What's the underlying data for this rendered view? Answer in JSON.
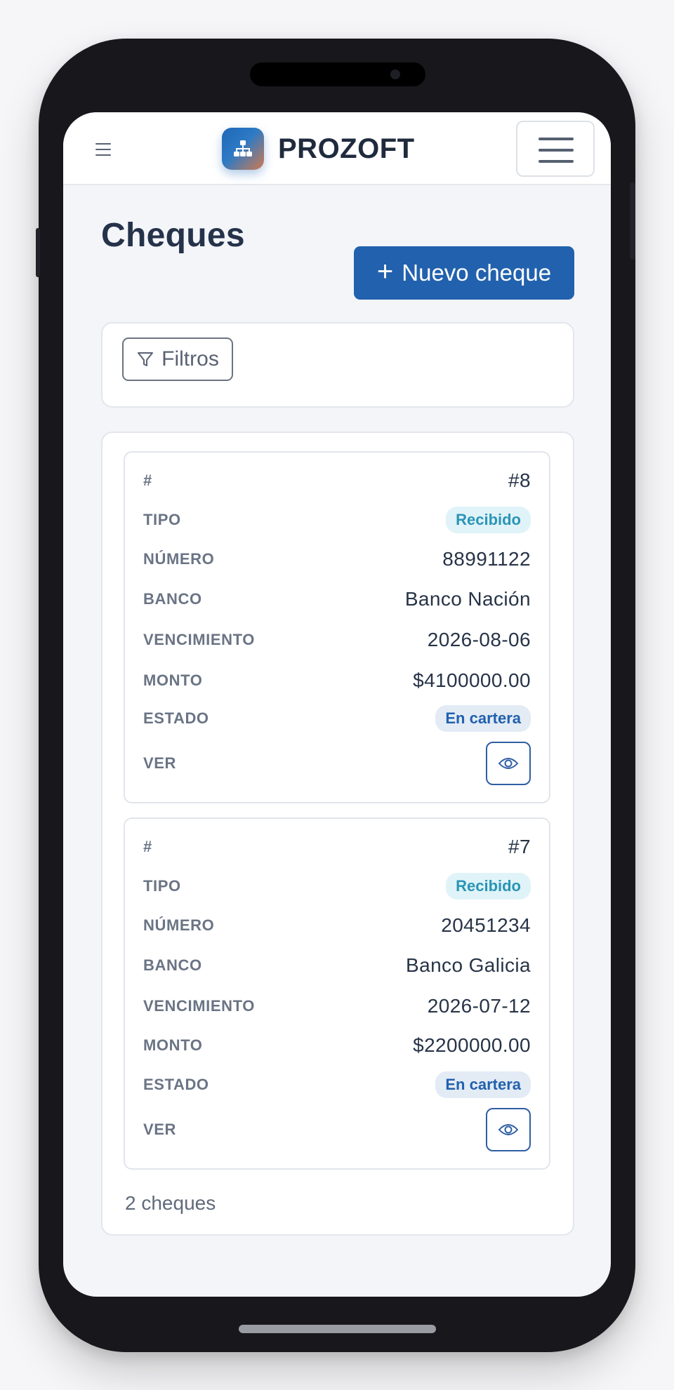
{
  "header": {
    "brand": "PROZOFT"
  },
  "page": {
    "title": "Cheques",
    "new_button_label": "Nuevo cheque",
    "filters_label": "Filtros"
  },
  "labels": {
    "id": "#",
    "tipo": "TIPO",
    "numero": "NÚMERO",
    "banco": "BANCO",
    "vencimiento": "VENCIMIENTO",
    "monto": "MONTO",
    "estado": "ESTADO",
    "ver": "VER"
  },
  "cheques": [
    {
      "id": "#8",
      "tipo": "Recibido",
      "numero": "88991122",
      "banco": "Banco Nación",
      "vencimiento": "2026-08-06",
      "monto": "$4100000.00",
      "estado": "En cartera"
    },
    {
      "id": "#7",
      "tipo": "Recibido",
      "numero": "20451234",
      "banco": "Banco Galicia",
      "vencimiento": "2026-07-12",
      "monto": "$2200000.00",
      "estado": "En cartera"
    }
  ],
  "footer": {
    "count_text": "2 cheques"
  },
  "icons": {
    "menu": "hamburger-icon",
    "logo": "org-chart-icon",
    "add": "plus-icon",
    "filter": "filter-funnel-icon",
    "view": "eye-icon"
  },
  "colors": {
    "primary": "#2261ad",
    "badge_recibido_bg": "#e0f3f8",
    "badge_recibido_text": "#2a95b6",
    "badge_cartera_bg": "#e3ebf5",
    "badge_cartera_text": "#2261ad"
  }
}
